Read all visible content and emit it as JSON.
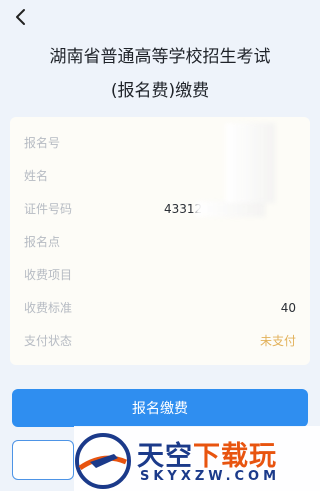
{
  "header": {
    "title_line1": "湖南省普通高等学校招生考试",
    "title_line2": "(报名费)缴费"
  },
  "fields": [
    {
      "label": "报名号",
      "value": ""
    },
    {
      "label": "姓名",
      "value": ""
    },
    {
      "label": "证件号码",
      "value": "43312"
    },
    {
      "label": "报名点",
      "value": ""
    },
    {
      "label": "收费项目",
      "value": ""
    },
    {
      "label": "收费标准",
      "value": "40"
    },
    {
      "label": "支付状态",
      "value": "未支付"
    }
  ],
  "actions": {
    "pay_label": "报名缴费"
  },
  "watermark": {
    "brand_part1": "天空",
    "brand_part2": "下载玩",
    "url": "SKYXZW.COM"
  },
  "colors": {
    "primary": "#2f8ef0",
    "status_unpaid": "#e2b15a",
    "background": "#eef3fa"
  }
}
